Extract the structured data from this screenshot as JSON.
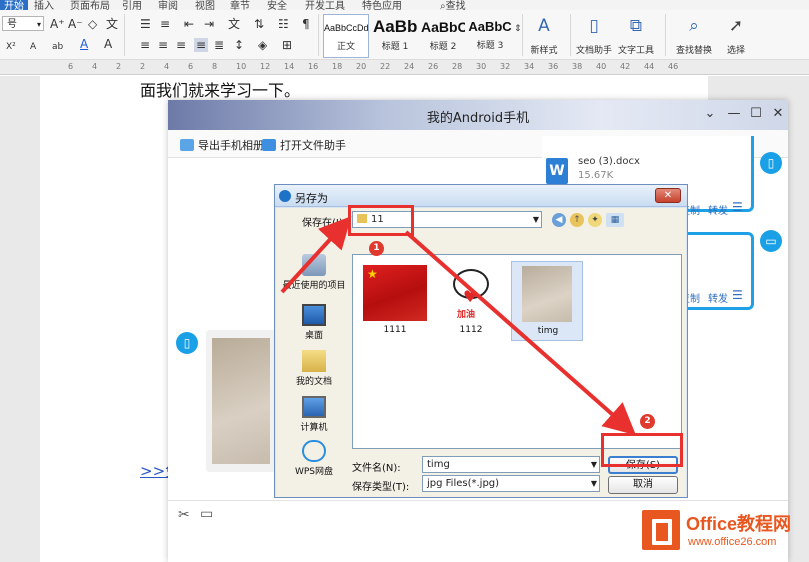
{
  "menubar": {
    "tabs": [
      "开始",
      "插入",
      "页面布局",
      "引用",
      "审阅",
      "视图",
      "章节",
      "安全",
      "开发工具",
      "特色应用"
    ],
    "search": "查找"
  },
  "ribbon": {
    "font_size": "号",
    "styles": [
      {
        "sample": "AaBbCcDd",
        "name": "正文"
      },
      {
        "sample": "AaBb",
        "name": "标题 1"
      },
      {
        "sample": "AaBbC",
        "name": "标题 2"
      },
      {
        "sample": "AaBbC",
        "name": "标题 3"
      }
    ],
    "tools": [
      {
        "label": "新样式",
        "icon": "new-style-icon"
      },
      {
        "label": "文档助手",
        "icon": "doc-assistant-icon"
      },
      {
        "label": "文字工具",
        "icon": "text-tools-icon"
      },
      {
        "label": "查找替换",
        "icon": "find-replace-icon"
      },
      {
        "label": "选择",
        "icon": "select-icon"
      }
    ]
  },
  "ruler": {
    "numbers": [
      "6",
      "4",
      "2",
      "2",
      "4",
      "6",
      "8",
      "10",
      "12",
      "14",
      "16",
      "18",
      "20",
      "22",
      "24",
      "26",
      "28",
      "30",
      "32",
      "34",
      "36",
      "38",
      "40",
      "42",
      "44",
      "46"
    ]
  },
  "document": {
    "line": "面我们就来学习一下。",
    "link": ">>免"
  },
  "android": {
    "title": "我的Android手机",
    "toolbar": {
      "export_label": "导出手机相册",
      "open_label": "打开文件助手"
    },
    "file_msg": {
      "name": "seo (3).docx",
      "size": "15.67K"
    },
    "actions": {
      "copy": "复制",
      "forward": "转发"
    }
  },
  "dialog": {
    "title": "另存为",
    "save_in_label": "保存在(I):",
    "folder": "11",
    "places": [
      "最近使用的项目",
      "桌面",
      "我的文档",
      "计算机",
      "WPS网盘"
    ],
    "files": [
      {
        "name": "1111"
      },
      {
        "name": "1112",
        "caption": "加油"
      },
      {
        "name": "timg"
      }
    ],
    "filename_label": "文件名(N):",
    "filename": "timg",
    "filetype_label": "保存类型(T):",
    "filetype": "jpg Files(*.jpg)",
    "save_btn": "保存(S)",
    "cancel_btn": "取消"
  },
  "annotations": {
    "badge1": "1",
    "badge2": "2"
  },
  "watermark": {
    "line1": "Office教程网",
    "line2": "www.office26.com"
  },
  "colors": {
    "accent_blue": "#1ea0e6",
    "annotation_red": "#e8312f",
    "watermark_orange": "#e8571f"
  }
}
